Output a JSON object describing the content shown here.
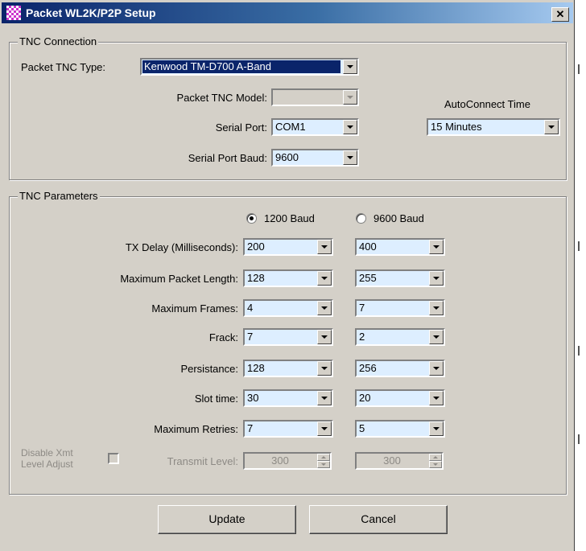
{
  "window": {
    "title": "Packet WL2K/P2P Setup",
    "close_glyph": "✕",
    "icon": "app-checker-icon"
  },
  "tnc_connection": {
    "group_title": "TNC Connection",
    "tnc_type_label": "Packet TNC Type:",
    "tnc_type_value": "Kenwood TM-D700 A-Band",
    "tnc_model_label": "Packet TNC Model:",
    "tnc_model_value": "",
    "serial_port_label": "Serial Port:",
    "serial_port_value": "COM1",
    "serial_baud_label": "Serial Port Baud:",
    "serial_baud_value": "9600",
    "autoconnect_label": "AutoConnect Time",
    "autoconnect_value": "15 Minutes"
  },
  "tnc_parameters": {
    "group_title": "TNC Parameters",
    "baud_1200_label": "1200 Baud",
    "baud_9600_label": "9600 Baud",
    "selected_baud": "1200 Baud",
    "rows": [
      {
        "label": "TX Delay (Milliseconds):",
        "v1200": "200",
        "v9600": "400"
      },
      {
        "label": "Maximum Packet Length:",
        "v1200": "128",
        "v9600": "255"
      },
      {
        "label": "Maximum Frames:",
        "v1200": "4",
        "v9600": "7"
      },
      {
        "label": "Frack:",
        "v1200": "7",
        "v9600": "2"
      },
      {
        "label": "Persistance:",
        "v1200": "128",
        "v9600": "256"
      },
      {
        "label": "Slot time:",
        "v1200": "30",
        "v9600": "20"
      },
      {
        "label": "Maximum Retries:",
        "v1200": "7",
        "v9600": "5"
      }
    ],
    "disable_xmt_label_line1": "Disable Xmt",
    "disable_xmt_label_line2": "Level Adjust",
    "disable_xmt_checked": false,
    "transmit_level_label": "Transmit Level:",
    "transmit_level_1200": "300",
    "transmit_level_9600": "300"
  },
  "buttons": {
    "update_label": "Update",
    "cancel_label": "Cancel"
  },
  "colors": {
    "dialog_face": "#d4d0c8",
    "field_background": "#ddeeff",
    "title_gradient_start": "#0a246a",
    "title_gradient_end": "#a6caf0",
    "selection": "#0a246a",
    "disabled_text": "#8d8a85"
  }
}
